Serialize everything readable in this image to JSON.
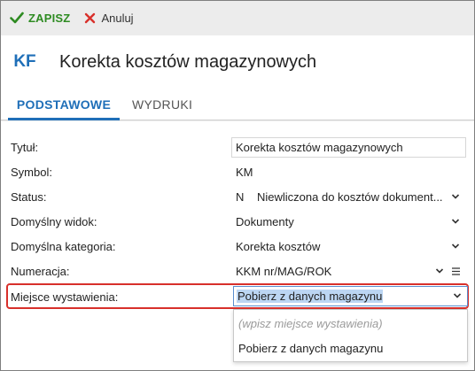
{
  "toolbar": {
    "save_label": "ZAPISZ",
    "cancel_label": "Anuluj",
    "save_icon": "checkmark-icon",
    "cancel_icon": "close-icon"
  },
  "header": {
    "badge": "KF",
    "title": "Korekta kosztów magazynowych"
  },
  "tabs": [
    {
      "label": "PODSTAWOWE",
      "active": true
    },
    {
      "label": "WYDRUKI",
      "active": false
    }
  ],
  "form": {
    "title": {
      "label": "Tytuł:",
      "value": "Korekta kosztów magazynowych"
    },
    "symbol": {
      "label": "Symbol:",
      "value": "KM"
    },
    "status": {
      "label": "Status:",
      "code": "N",
      "value": "Niewliczona do kosztów dokument..."
    },
    "default_view": {
      "label": "Domyślny widok:",
      "value": "Dokumenty"
    },
    "default_category": {
      "label": "Domyślna kategoria:",
      "value": "Korekta kosztów"
    },
    "numbering": {
      "label": "Numeracja:",
      "value": "KKM nr/MAG/ROK"
    },
    "place": {
      "label": "Miejsce wystawienia:",
      "value": "Pobierz z danych magazynu"
    }
  },
  "dropdown": {
    "placeholder": "(wpisz miejsce wystawienia)",
    "options": [
      "Pobierz z danych magazynu"
    ]
  },
  "colors": {
    "accent": "#1f6fb8",
    "save": "#2e8b22",
    "cancel": "#d8302b",
    "highlight": "#d8302b"
  }
}
